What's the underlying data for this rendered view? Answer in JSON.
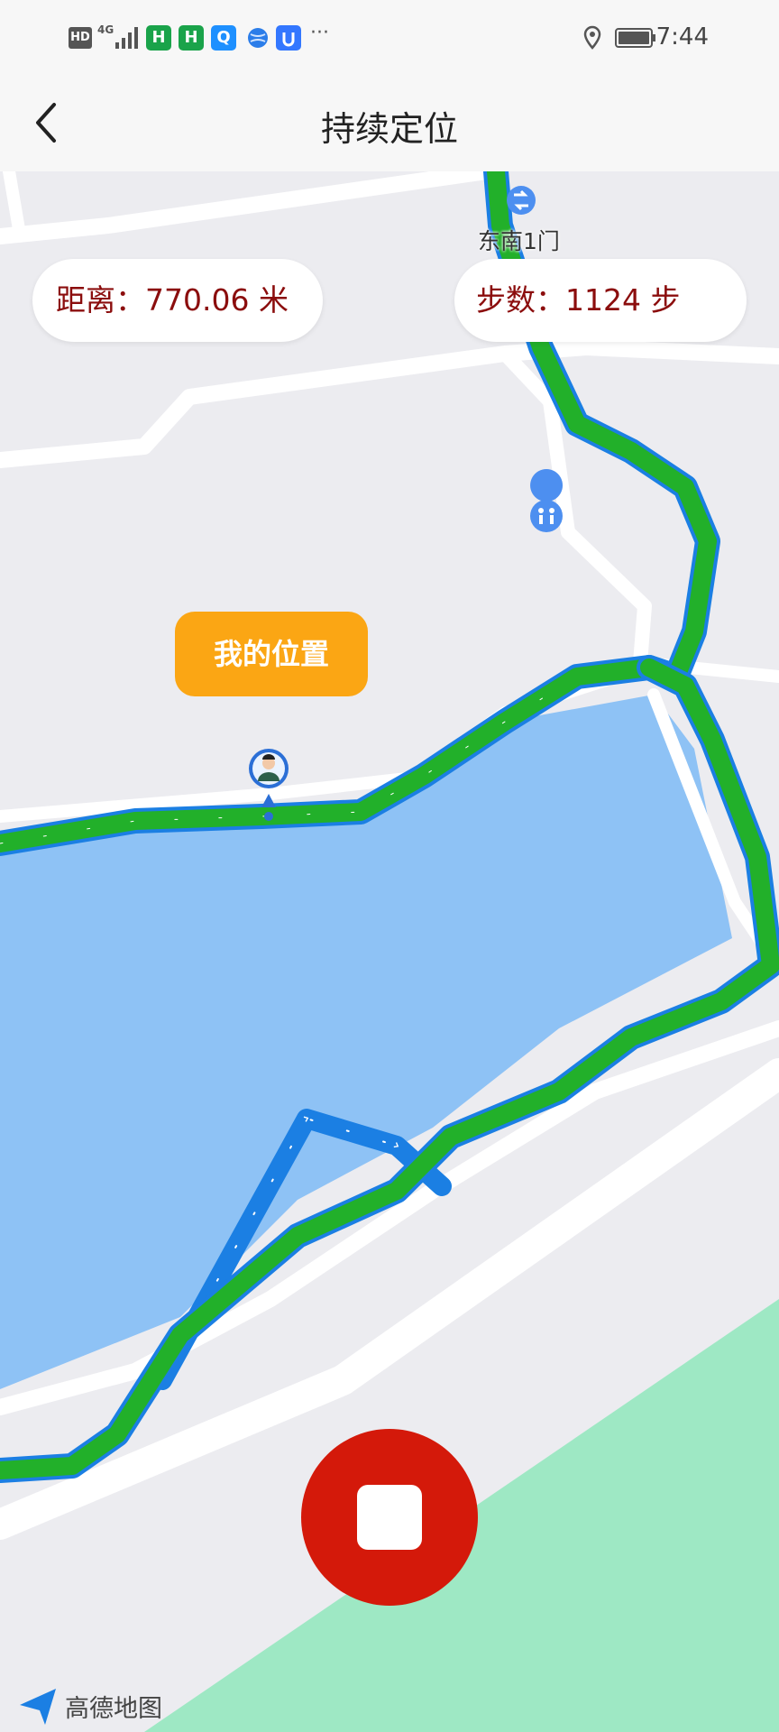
{
  "status_bar": {
    "hd": "HD",
    "network": "4G",
    "app_icons": [
      {
        "name": "h-app-icon",
        "label": "H",
        "color": "#1aa34a"
      },
      {
        "name": "h-app-2-icon",
        "label": "H",
        "color": "#1aa34a"
      },
      {
        "name": "search-app-icon",
        "label": "Q",
        "color": "#1e90ff"
      },
      {
        "name": "browser-app-icon",
        "label": "",
        "color": "#2b7de9"
      },
      {
        "name": "shield-app-icon",
        "label": "",
        "color": "#3377ff"
      }
    ],
    "more": "···",
    "time": "7:44"
  },
  "header": {
    "title": "持续定位"
  },
  "map": {
    "distance_label": "距离：770.06 米",
    "steps_label": "步数：1124 步",
    "my_location_label": "我的位置",
    "poi_gate_label": "东南1门",
    "provider_label": "高德地图",
    "colors": {
      "water": "#8ec2f5",
      "green_area": "#9ee8c4",
      "track_green": "#22b02a",
      "track_blue": "#1b7fe3",
      "stop": "#d4190a",
      "badge": "#fba614"
    }
  }
}
